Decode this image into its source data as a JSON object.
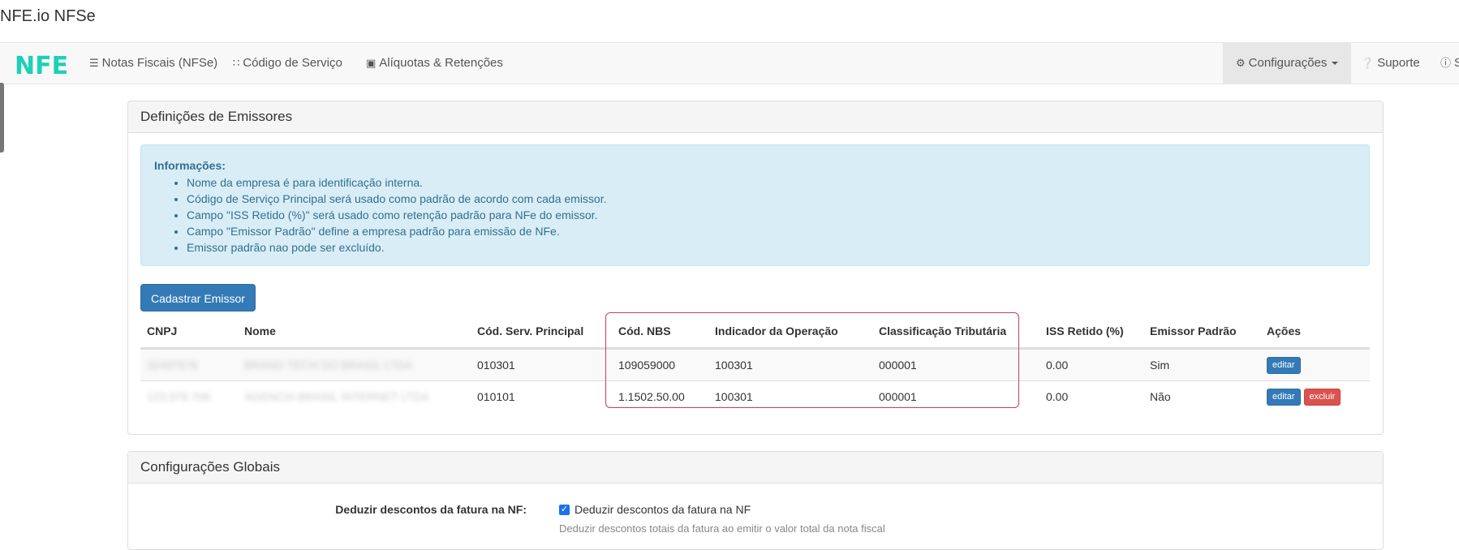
{
  "app_title": "NFE.io NFSe",
  "navbar": {
    "brand": "NFE",
    "items": [
      {
        "icon": "list-icon",
        "label": "Notas Fiscais (NFSe)"
      },
      {
        "icon": "sitemap-icon",
        "label": "Código de Serviço"
      },
      {
        "icon": "inbox-icon",
        "label": "Alíquotas & Retenções"
      }
    ],
    "right_items": [
      {
        "icon": "gear-icon",
        "label": "Configurações"
      },
      {
        "icon": "question-circle-icon",
        "label": "Suporte"
      },
      {
        "icon": "info-circle-icon",
        "label": "S"
      }
    ]
  },
  "emissores_panel": {
    "heading": "Definições de Emissores",
    "info": {
      "title": "Informações:",
      "items": [
        "Nome da empresa é para identificação interna.",
        "Código de Serviço Principal será usado como padrão de acordo com cada emissor.",
        "Campo \"ISS Retido (%)\" será usado como retenção padrão para NFe do emissor.",
        "Campo \"Emissor Padrão\" define a empresa padrão para emissão de NFe.",
        "Emissor padrão nao pode ser excluído."
      ]
    },
    "add_button": "Cadastrar Emissor",
    "table": {
      "headers": [
        "CNPJ",
        "Nome",
        "Cód. Serv. Principal",
        "Cód. NBS",
        "Indicador da Operação",
        "Classificação Tributária",
        "ISS Retido (%)",
        "Emissor Padrão",
        "Ações"
      ],
      "rows": [
        {
          "cnpj": "32497676",
          "nome": "BRAND TECH DO BRASIL LTDA",
          "cod_serv": "010301",
          "cod_nbs": "109059000",
          "indicador": "100301",
          "classificacao": "000001",
          "iss": "0.00",
          "padrao": "Sim",
          "actions": [
            "editar"
          ]
        },
        {
          "cnpj": "123.978.706",
          "nome": "AGENCIA BRASIL INTERNET LTDA",
          "cod_serv": "010101",
          "cod_nbs": "1.1502.50.00",
          "indicador": "100301",
          "classificacao": "000001",
          "iss": "0.00",
          "padrao": "Não",
          "actions": [
            "editar",
            "excluir"
          ]
        }
      ]
    }
  },
  "global_panel": {
    "heading": "Configurações Globais",
    "field_label": "Deduzir descontos da fatura na NF:",
    "checkbox_label": "Deduzir descontos da fatura na NF",
    "help_text": "Deduzir descontos totais da fatura ao emitir o valor total da nota fiscal"
  },
  "colors": {
    "brand": "#1bd1b8",
    "primary": "#337ab7",
    "danger": "#d9534f",
    "highlight_border": "#c0405f",
    "info_bg": "#d9edf7"
  }
}
